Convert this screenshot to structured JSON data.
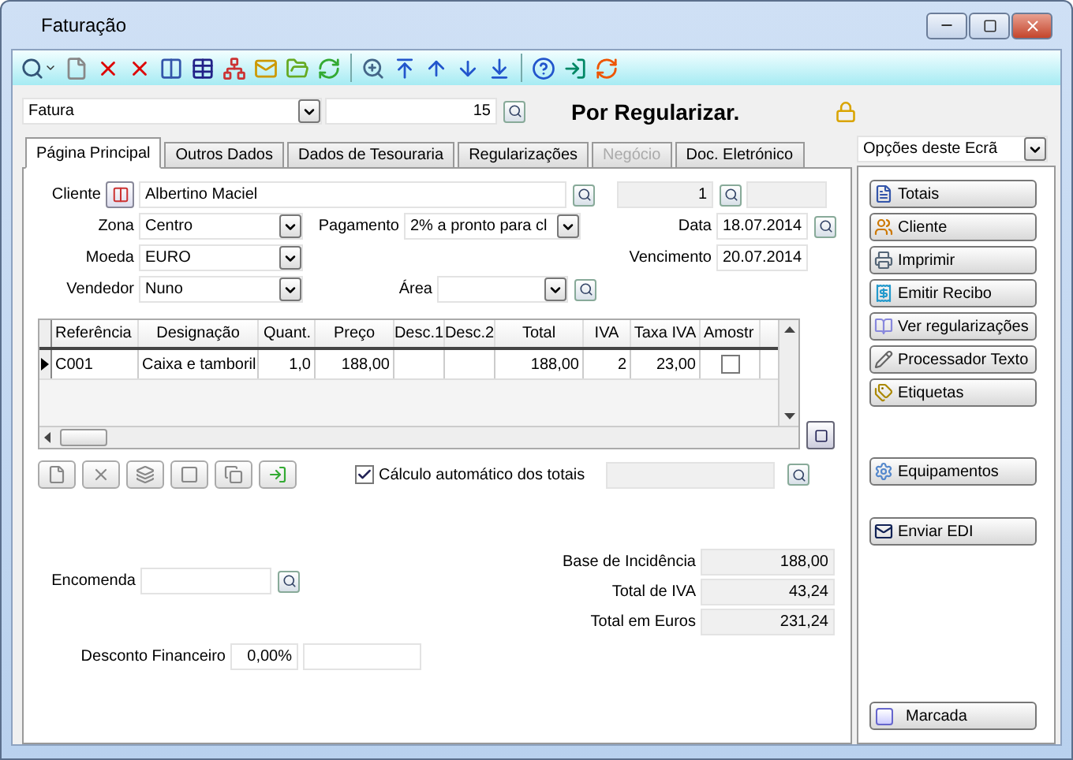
{
  "window": {
    "title": "Faturação"
  },
  "document": {
    "type": "Fatura",
    "number": "15",
    "status": "Por Regularizar."
  },
  "tabs": [
    {
      "label": "Página Principal",
      "selected": true,
      "disabled": false
    },
    {
      "label": "Outros Dados",
      "selected": false,
      "disabled": false
    },
    {
      "label": "Dados de Tesouraria",
      "selected": false,
      "disabled": false
    },
    {
      "label": "Regularizações",
      "selected": false,
      "disabled": false
    },
    {
      "label": "Negócio",
      "selected": false,
      "disabled": true
    },
    {
      "label": "Doc. Eletrónico",
      "selected": false,
      "disabled": false
    }
  ],
  "form": {
    "cliente": {
      "label": "Cliente",
      "value": "Albertino Maciel",
      "number": "1"
    },
    "zona": {
      "label": "Zona",
      "value": "Centro"
    },
    "pagamento": {
      "label": "Pagamento",
      "value": "2% a pronto para cl"
    },
    "data": {
      "label": "Data",
      "value": "18.07.2014"
    },
    "moeda": {
      "label": "Moeda",
      "value": "EURO"
    },
    "vencimento": {
      "label": "Vencimento",
      "value": "20.07.2014"
    },
    "vendedor": {
      "label": "Vendedor",
      "value": "Nuno"
    },
    "area": {
      "label": "Área"
    }
  },
  "table": {
    "columns": [
      "Referência",
      "Designação",
      "Quant.",
      "Preço",
      "Desc.1",
      "Desc.2",
      "Total",
      "IVA",
      "Taxa IVA",
      "Amostr"
    ],
    "rows": [
      {
        "current": true,
        "cells": [
          "C001",
          "Caixa e tamboril",
          "1,0",
          "188,00",
          "",
          "",
          "188,00",
          "2",
          "23,00"
        ],
        "checked": false
      }
    ]
  },
  "auto_totals": {
    "label": "Cálculo automático dos totais",
    "checked": true
  },
  "encomenda": {
    "label": "Encomenda"
  },
  "totals": [
    {
      "label": "Base de Incidência",
      "value": "188,00"
    },
    {
      "label": "Total de IVA",
      "value": "43,24"
    },
    {
      "label": "Total em Euros",
      "value": "231,24"
    }
  ],
  "desconto": {
    "label": "Desconto Financeiro",
    "value": "0,00%"
  },
  "side_panel": {
    "title": "Opções deste Ecrã",
    "groups": [
      [
        "Totais",
        "Cliente",
        "Imprimir",
        "Emitir Recibo",
        "Ver regularizações",
        "Processador Texto",
        "Etiquetas"
      ],
      [
        "Equipamentos"
      ],
      [
        "Enviar EDI"
      ]
    ],
    "marcada": {
      "label": "Marcada"
    }
  }
}
